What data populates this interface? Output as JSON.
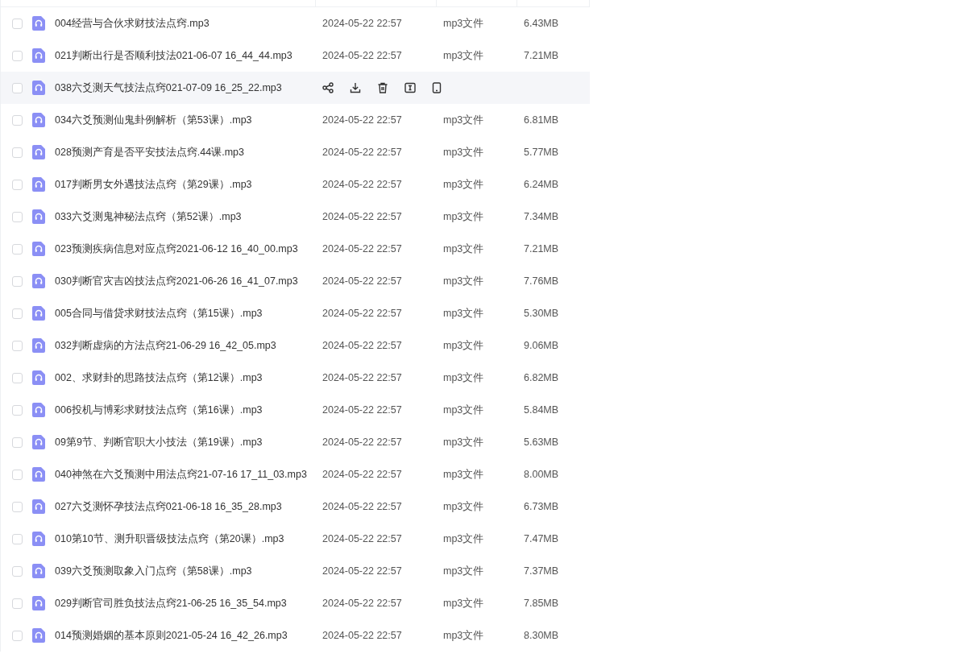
{
  "file_list": {
    "rows": [
      {
        "name": "004经营与合伙求财技法点窍.mp3",
        "date": "2024-05-22 22:57",
        "type": "mp3文件",
        "size": "6.43MB",
        "checked": false,
        "hovered": false
      },
      {
        "name": "021判断出行是否顺利技法021-06-07 16_44_44.mp3",
        "date": "2024-05-22 22:57",
        "type": "mp3文件",
        "size": "7.21MB",
        "checked": false,
        "hovered": false
      },
      {
        "name": "038六爻测天气技法点窍021-07-09 16_25_22.mp3",
        "checked": false,
        "hovered": true
      },
      {
        "name": "034六爻预测仙鬼卦例解析（第53课）.mp3",
        "date": "2024-05-22 22:57",
        "type": "mp3文件",
        "size": "6.81MB",
        "checked": false,
        "hovered": false
      },
      {
        "name": "028预测产育是否平安技法点窍.44课.mp3",
        "date": "2024-05-22 22:57",
        "type": "mp3文件",
        "size": "5.77MB",
        "checked": false,
        "hovered": false
      },
      {
        "name": "017判断男女外遇技法点窍（第29课）.mp3",
        "date": "2024-05-22 22:57",
        "type": "mp3文件",
        "size": "6.24MB",
        "checked": false,
        "hovered": false
      },
      {
        "name": "033六爻测鬼神秘法点窍（第52课）.mp3",
        "date": "2024-05-22 22:57",
        "type": "mp3文件",
        "size": "7.34MB",
        "checked": false,
        "hovered": false
      },
      {
        "name": "023预测疾病信息对应点窍2021-06-12 16_40_00.mp3",
        "date": "2024-05-22 22:57",
        "type": "mp3文件",
        "size": "7.21MB",
        "checked": false,
        "hovered": false
      },
      {
        "name": "030判断官灾吉凶技法点窍2021-06-26 16_41_07.mp3",
        "date": "2024-05-22 22:57",
        "type": "mp3文件",
        "size": "7.76MB",
        "checked": false,
        "hovered": false
      },
      {
        "name": "005合同与借贷求财技法点窍（第15课）.mp3",
        "date": "2024-05-22 22:57",
        "type": "mp3文件",
        "size": "5.30MB",
        "checked": false,
        "hovered": false
      },
      {
        "name": "032判断虚病的方法点窍21-06-29 16_42_05.mp3",
        "date": "2024-05-22 22:57",
        "type": "mp3文件",
        "size": "9.06MB",
        "checked": false,
        "hovered": false
      },
      {
        "name": "002、求财卦的思路技法点窍（第12课）.mp3",
        "date": "2024-05-22 22:57",
        "type": "mp3文件",
        "size": "6.82MB",
        "checked": false,
        "hovered": false
      },
      {
        "name": "006投机与博彩求财技法点窍（第16课）.mp3",
        "date": "2024-05-22 22:57",
        "type": "mp3文件",
        "size": "5.84MB",
        "checked": false,
        "hovered": false
      },
      {
        "name": "09第9节、判断官职大小技法（第19课）.mp3",
        "date": "2024-05-22 22:57",
        "type": "mp3文件",
        "size": "5.63MB",
        "checked": false,
        "hovered": false
      },
      {
        "name": "040神煞在六爻预测中用法点窍21-07-16 17_11_03.mp3",
        "date": "2024-05-22 22:57",
        "type": "mp3文件",
        "size": "8.00MB",
        "checked": false,
        "hovered": false
      },
      {
        "name": "027六爻测怀孕技法点窍021-06-18 16_35_28.mp3",
        "date": "2024-05-22 22:57",
        "type": "mp3文件",
        "size": "6.73MB",
        "checked": false,
        "hovered": false
      },
      {
        "name": "010第10节、测升职晋级技法点窍（第20课）.mp3",
        "date": "2024-05-22 22:57",
        "type": "mp3文件",
        "size": "7.47MB",
        "checked": false,
        "hovered": false
      },
      {
        "name": "039六爻预测取象入门点窍（第58课）.mp3",
        "date": "2024-05-22 22:57",
        "type": "mp3文件",
        "size": "7.37MB",
        "checked": false,
        "hovered": false
      },
      {
        "name": "029判断官司胜负技法点窍21-06-25 16_35_54.mp3",
        "date": "2024-05-22 22:57",
        "type": "mp3文件",
        "size": "7.85MB",
        "checked": false,
        "hovered": false
      },
      {
        "name": "014预测婚姻的基本原则2021-05-24 16_42_26.mp3",
        "date": "2024-05-22 22:57",
        "type": "mp3文件",
        "size": "8.30MB",
        "checked": false,
        "hovered": false
      }
    ]
  }
}
